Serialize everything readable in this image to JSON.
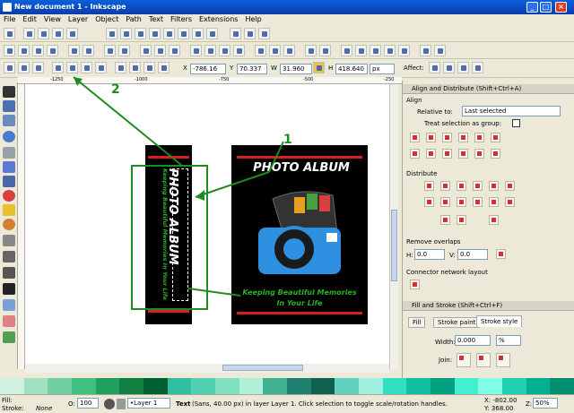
{
  "window": {
    "title": "New document 1 - Inkscape",
    "min": "_",
    "max": "□",
    "close": "×"
  },
  "menu": [
    "File",
    "Edit",
    "View",
    "Layer",
    "Object",
    "Path",
    "Text",
    "Filters",
    "Extensions",
    "Help"
  ],
  "tool_controls": {
    "x_label": "X",
    "x": "-786.16",
    "y_label": "Y",
    "y": "70.337",
    "w_label": "W",
    "w": "31.960",
    "h_label": "H",
    "h": "418.640",
    "unit": "px",
    "affect": "Affect:"
  },
  "ruler": {
    "mark1": "-1250",
    "mark2": "-1000",
    "mark3": "-750",
    "mark4": "-500",
    "mark5": "-250"
  },
  "annotations": {
    "one": "1",
    "two": "2"
  },
  "artwork": {
    "title": "PHOTO ALBUM",
    "tagline1": "Keeping Beautiful Memories",
    "tagline2": "In Your Life",
    "spine_title": "PHOTO ALBUM",
    "spine_tag": "Keeping Beautiful Memories In Your Life"
  },
  "align_panel": {
    "title": "Align and Distribute (Shift+Ctrl+A)",
    "align": "Align",
    "relative_to": "Relative to:",
    "relative_value": "Last selected",
    "group": "Treat selection as group:",
    "distribute": "Distribute",
    "overlaps": "Remove overlaps",
    "h_label": "H:",
    "h_val": "0.0",
    "v_label": "V:",
    "v_val": "0.0",
    "connector": "Connector network layout"
  },
  "fill_panel": {
    "title": "Fill and Stroke (Shift+Ctrl+F)",
    "tab_fill": "Fill",
    "tab_paint": "Stroke paint",
    "tab_style": "Stroke style",
    "width_label": "Width:",
    "width": "0.000",
    "width_unit": "%",
    "join": "Join:"
  },
  "status": {
    "fill": "Fill:",
    "stroke": "Stroke:",
    "stroke_val": "None",
    "opacity_label": "O:",
    "opacity": "100",
    "layer": "•Layer 1",
    "message_bold": "Text",
    "message": " (Sans, 40.00 px) in layer Layer 1. Click selection to toggle scale/rotation handles.",
    "x": "X: -802.00",
    "y": "Y: 368.00",
    "z": "Z:",
    "zoom": "50%"
  },
  "colors": {
    "accent": "#0a3ca8",
    "red": "#d81e1e",
    "green": "#1e8c1e",
    "spine_text": "#2bb02b"
  }
}
